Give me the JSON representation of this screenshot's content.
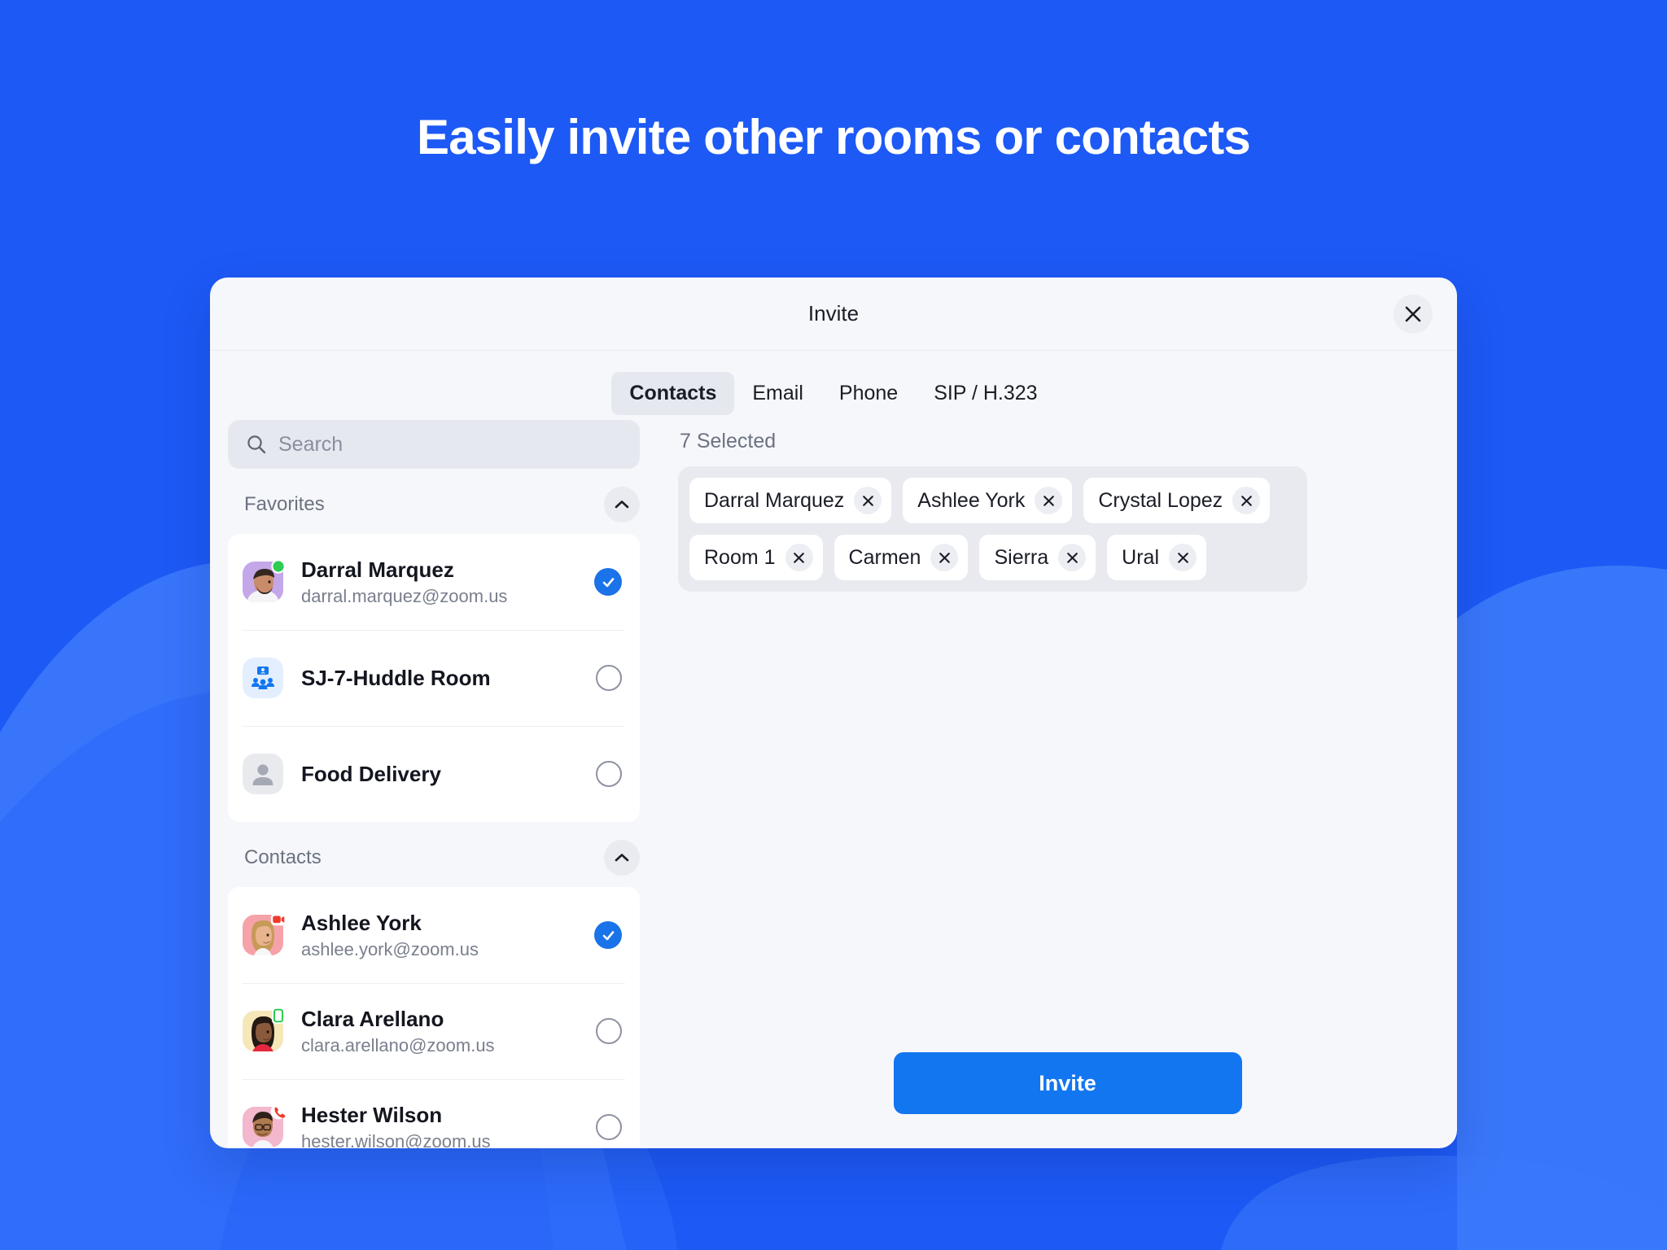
{
  "hero": {
    "title": "Easily invite other rooms or contacts"
  },
  "colors": {
    "background_blue": "#1D59F5",
    "wave_light": "#2E6BFA",
    "wave_lighter": "#3D7AFB",
    "dialog_bg": "#F6F7FA",
    "accent_blue": "#1276F0",
    "check_blue": "#1A73E8",
    "chip_tray": "#E8EAF0",
    "online_green": "#2ECC52",
    "busy_red": "#F0392B"
  },
  "dialog": {
    "title": "Invite",
    "close_icon": "close-icon"
  },
  "tabs": [
    {
      "label": "Contacts",
      "active": true
    },
    {
      "label": "Email",
      "active": false
    },
    {
      "label": "Phone",
      "active": false
    },
    {
      "label": "SIP / H.323",
      "active": false
    }
  ],
  "search": {
    "placeholder": "Search",
    "value": "",
    "icon": "search-icon"
  },
  "sections": [
    {
      "title": "Favorites",
      "collapse_icon": "chevron-up-icon",
      "rows": [
        {
          "name": "Darral Marquez",
          "email": "darral.marquez@zoom.us",
          "avatar_type": "photo-male-beard",
          "avatar_bg": "#C4A7E8",
          "presence": "online",
          "selected": true
        },
        {
          "name": "SJ-7-Huddle Room",
          "email": "",
          "avatar_type": "huddle-room-icon",
          "avatar_bg": "#E3EEFE",
          "presence": "none",
          "selected": false
        },
        {
          "name": "Food Delivery",
          "email": "",
          "avatar_type": "person-placeholder-icon",
          "avatar_bg": "#E8EAEE",
          "presence": "none",
          "selected": false
        }
      ]
    },
    {
      "title": "Contacts",
      "collapse_icon": "chevron-up-icon",
      "rows": [
        {
          "name": "Ashlee York",
          "email": "ashlee.york@zoom.us",
          "avatar_type": "photo-female-blonde",
          "avatar_bg": "#F5A3A8",
          "presence": "in-meeting",
          "selected": true
        },
        {
          "name": "Clara Arellano",
          "email": "clara.arellano@zoom.us",
          "avatar_type": "photo-female-dark",
          "avatar_bg": "#F6E7B8",
          "presence": "mobile",
          "selected": false
        },
        {
          "name": "Hester Wilson",
          "email": "hester.wilson@zoom.us",
          "avatar_type": "photo-male-glasses",
          "avatar_bg": "#F3B8CE",
          "presence": "on-call",
          "selected": false
        }
      ]
    }
  ],
  "selection": {
    "count_label": "7 Selected",
    "chips": [
      {
        "label": "Darral Marquez",
        "remove_icon": "close-icon"
      },
      {
        "label": "Ashlee York",
        "remove_icon": "close-icon"
      },
      {
        "label": "Crystal Lopez",
        "remove_icon": "close-icon"
      },
      {
        "label": "Room 1",
        "remove_icon": "close-icon"
      },
      {
        "label": "Carmen",
        "remove_icon": "close-icon"
      },
      {
        "label": "Sierra",
        "remove_icon": "close-icon"
      },
      {
        "label": "Ural",
        "remove_icon": "close-icon"
      }
    ]
  },
  "footer": {
    "invite_label": "Invite"
  }
}
